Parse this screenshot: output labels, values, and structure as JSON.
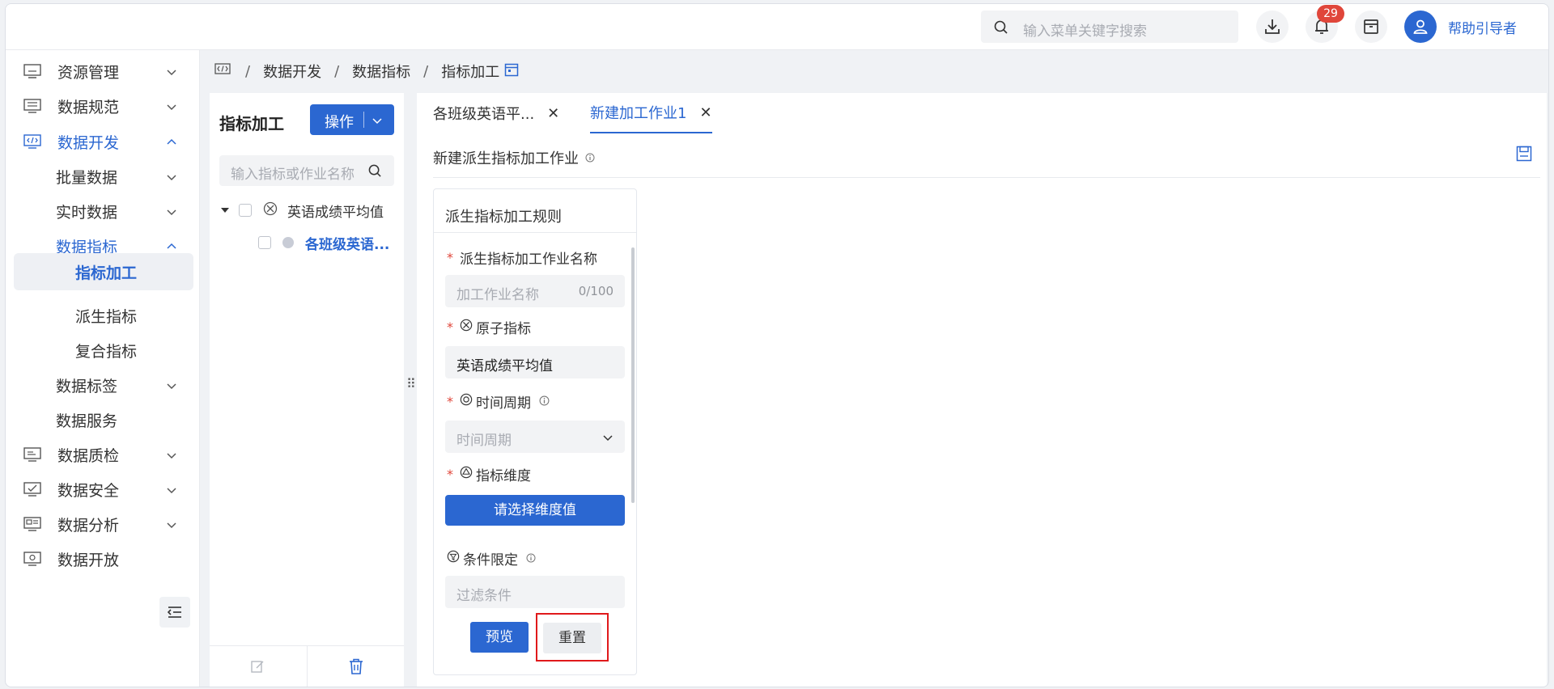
{
  "header": {
    "search_placeholder": "输入菜单关键字搜索",
    "notification_count": "29",
    "username": "帮助引导者"
  },
  "sidebar": {
    "items": [
      {
        "label": "资源管理"
      },
      {
        "label": "数据规范"
      },
      {
        "label": "数据开发"
      },
      {
        "label": "批量数据"
      },
      {
        "label": "实时数据"
      },
      {
        "label": "数据指标"
      },
      {
        "label": "指标加工"
      },
      {
        "label": "派生指标"
      },
      {
        "label": "复合指标"
      },
      {
        "label": "数据标签"
      },
      {
        "label": "数据服务"
      },
      {
        "label": "数据质检"
      },
      {
        "label": "数据安全"
      },
      {
        "label": "数据分析"
      },
      {
        "label": "数据开放"
      }
    ]
  },
  "breadcrumb": {
    "items": [
      "数据开发",
      "数据指标",
      "指标加工"
    ]
  },
  "tree_panel": {
    "title": "指标加工",
    "operate_label": "操作",
    "search_placeholder": "输入指标或作业名称",
    "nodes": [
      {
        "label": "英语成绩平均值"
      },
      {
        "label": "各班级英语..."
      }
    ]
  },
  "tabs": [
    {
      "label": "各班级英语平..."
    },
    {
      "label": "新建加工作业1"
    }
  ],
  "main": {
    "subtitle": "新建派生指标加工作业"
  },
  "rule_card": {
    "title": "派生指标加工规则",
    "job_name_label": "派生指标加工作业名称",
    "job_name_placeholder": "加工作业名称",
    "job_name_count": "0/100",
    "atomic_label": "原子指标",
    "atomic_value": "英语成绩平均值",
    "period_label": "时间周期",
    "period_placeholder": "时间周期",
    "dimension_label": "指标维度",
    "dimension_button": "请选择维度值",
    "condition_label": "条件限定",
    "condition_placeholder": "过滤条件",
    "preview_button": "预览",
    "reset_button": "重置"
  },
  "colors": {
    "primary": "#2b67d1",
    "badge": "#e0463a",
    "highlight_border": "#e0191b"
  }
}
